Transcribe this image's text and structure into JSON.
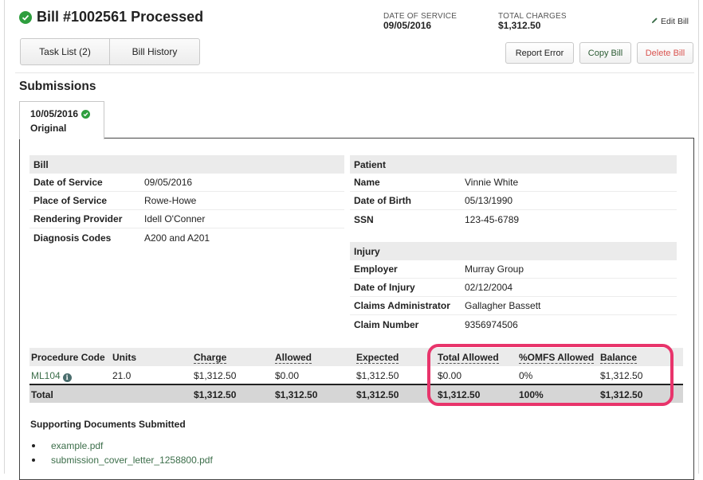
{
  "header": {
    "title": "Bill #1002561 Processed",
    "date_of_service_label": "DATE OF SERVICE",
    "date_of_service_value": "09/05/2016",
    "total_charges_label": "TOTAL CHARGES",
    "total_charges_value": "$1,312.50",
    "edit_bill_label": "Edit Bill"
  },
  "tabs": {
    "task_list": "Task List (2)",
    "bill_history": "Bill History"
  },
  "actions": {
    "report_error": "Report Error",
    "copy_bill": "Copy Bill",
    "delete_bill": "Delete Bill"
  },
  "colors": {
    "success": "#2e9e3e",
    "danger_text": "#d9534f",
    "highlight": "#e8346b",
    "link": "#3c6e4a"
  },
  "submissions": {
    "heading": "Submissions",
    "tab": {
      "date": "10/05/2016",
      "type": "Original"
    }
  },
  "bill": {
    "heading": "Bill",
    "rows": [
      {
        "label": "Date of Service",
        "value": "09/05/2016"
      },
      {
        "label": "Place of Service",
        "value": "Rowe-Howe"
      },
      {
        "label": "Rendering Provider",
        "value": "Idell O'Conner"
      },
      {
        "label": "Diagnosis Codes",
        "value": "A200 and A201"
      }
    ]
  },
  "patient": {
    "heading": "Patient",
    "rows": [
      {
        "label": "Name",
        "value": "Vinnie White"
      },
      {
        "label": "Date of Birth",
        "value": "05/13/1990"
      },
      {
        "label": "SSN",
        "value": "123-45-6789"
      }
    ]
  },
  "injury": {
    "heading": "Injury",
    "rows": [
      {
        "label": "Employer",
        "value": "Murray Group"
      },
      {
        "label": "Date of Injury",
        "value": "02/12/2004"
      },
      {
        "label": "Claims Administrator",
        "value": "Gallagher Bassett"
      },
      {
        "label": "Claim Number",
        "value": "9356974506"
      }
    ]
  },
  "procedures": {
    "columns": [
      "Procedure Code",
      "Units",
      "Charge",
      "Allowed",
      "Expected",
      "Total Allowed",
      "%OMFS Allowed",
      "Balance"
    ],
    "rows": [
      {
        "code": "ML104",
        "units": "21.0",
        "charge": "$1,312.50",
        "allowed": "$0.00",
        "expected": "$1,312.50",
        "total_allowed": "$0.00",
        "omfs": "0%",
        "balance": "$1,312.50"
      }
    ],
    "total": {
      "label": "Total",
      "charge": "$1,312.50",
      "allowed": "$1,312.50",
      "expected": "$1,312.50",
      "total_allowed": "$1,312.50",
      "omfs": "100%",
      "balance": "$1,312.50"
    }
  },
  "documents": {
    "heading": "Supporting Documents Submitted",
    "items": [
      "example.pdf",
      "submission_cover_letter_1258800.pdf"
    ]
  }
}
